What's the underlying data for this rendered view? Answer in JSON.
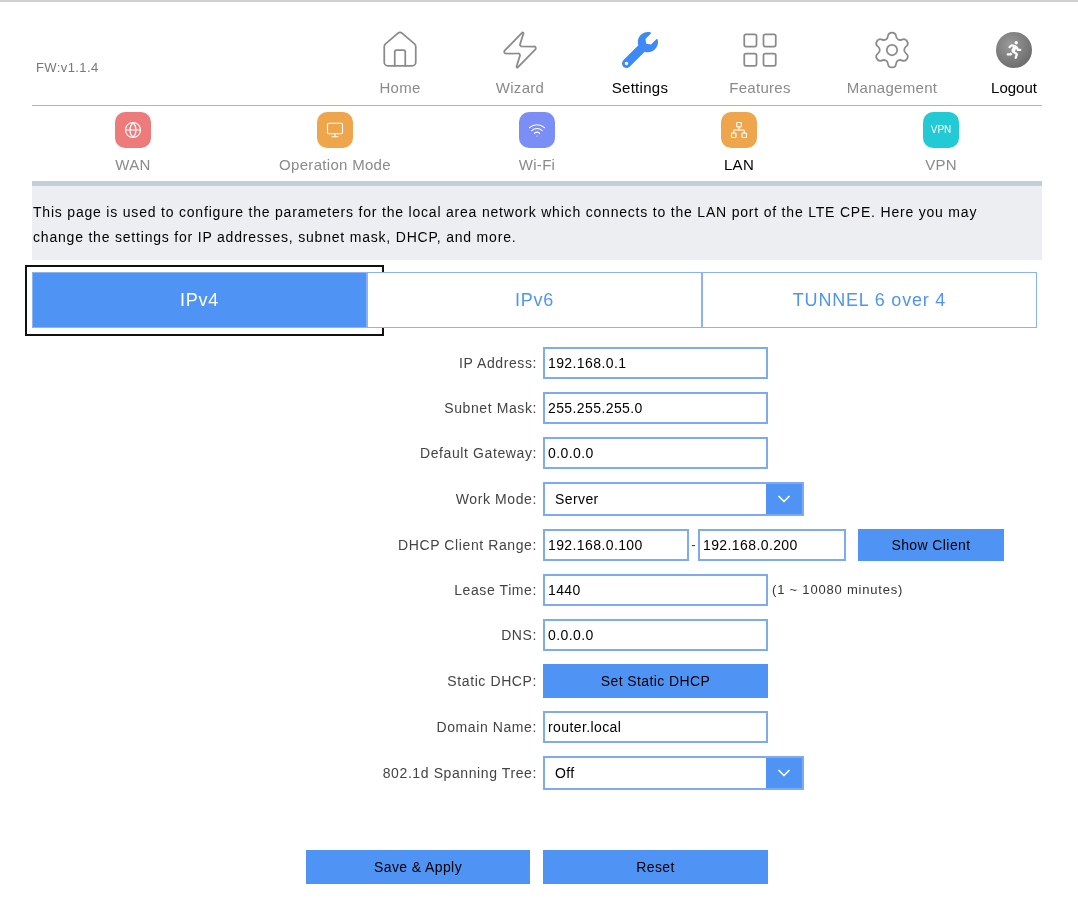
{
  "header": {
    "firmware": "FW:v1.1.4"
  },
  "nav": {
    "items": [
      {
        "label": "Home",
        "selected": false
      },
      {
        "label": "Wizard",
        "selected": false
      },
      {
        "label": "Settings",
        "selected": true
      },
      {
        "label": "Features",
        "selected": false
      },
      {
        "label": "Management",
        "selected": false
      }
    ],
    "logout": {
      "label": "Logout"
    }
  },
  "subnav": {
    "items": [
      {
        "label": "WAN",
        "selected": false,
        "color": "#ee7b7b"
      },
      {
        "label": "Operation Mode",
        "selected": false,
        "color": "#efa54c"
      },
      {
        "label": "Wi-Fi",
        "selected": false,
        "color": "#7b8ef5"
      },
      {
        "label": "LAN",
        "selected": true,
        "color": "#efa54c"
      },
      {
        "label": "VPN",
        "selected": false,
        "color": "#21cad5",
        "logo_text": "VPN"
      }
    ]
  },
  "description": "This page is used to configure the parameters for the local area network which connects to the LAN port of the LTE CPE. Here you may change the settings for IP addresses, subnet mask, DHCP, and more.",
  "tabs": [
    {
      "label": "IPv4",
      "selected": true,
      "focused": true
    },
    {
      "label": "IPv6",
      "selected": false,
      "focused": false
    },
    {
      "label": "TUNNEL 6 over 4",
      "selected": false,
      "focused": false
    }
  ],
  "form": {
    "rows": [
      {
        "kind": "input",
        "label": "IP Address:",
        "value": "192.168.0.1"
      },
      {
        "kind": "input",
        "label": "Subnet Mask:",
        "value": "255.255.255.0"
      },
      {
        "kind": "input",
        "label": "Default Gateway:",
        "value": "0.0.0.0"
      },
      {
        "kind": "select",
        "label": "Work Mode:",
        "value": "Server"
      },
      {
        "kind": "range",
        "label": "DHCP Client Range:",
        "start": "192.168.0.100",
        "separator": "-",
        "end": "192.168.0.200",
        "button": "Show Client"
      },
      {
        "kind": "input",
        "label": "Lease Time:",
        "value": "1440",
        "note": "(1 ~ 10080 minutes)"
      },
      {
        "kind": "input",
        "label": "DNS:",
        "value": "0.0.0.0"
      },
      {
        "kind": "button",
        "label": "Static DHCP:",
        "button": "Set Static DHCP"
      },
      {
        "kind": "input",
        "label": "Domain Name:",
        "value": "router.local"
      },
      {
        "kind": "select",
        "label": "802.1d Spanning Tree:",
        "value": "Off"
      }
    ]
  },
  "actions": [
    "Save & Apply",
    "Reset"
  ]
}
